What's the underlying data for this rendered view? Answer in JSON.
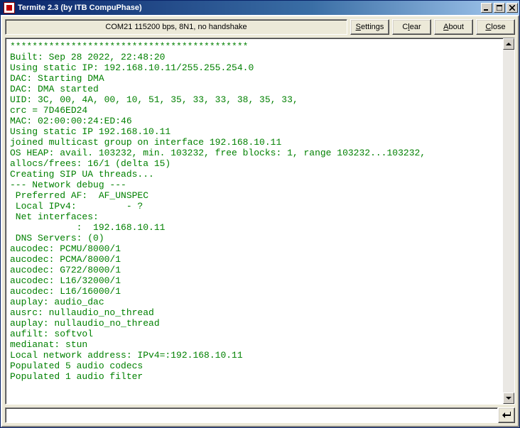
{
  "window": {
    "title": "Termite 2.3 (by ITB CompuPhase)"
  },
  "status": "COM21 115200 bps, 8N1, no handshake",
  "buttons": {
    "settings": "Settings",
    "clear": "Clear",
    "about": "About",
    "close": "Close"
  },
  "terminal_lines": [
    "*******************************************",
    "Built: Sep 28 2022, 22:48:20",
    "Using static IP: 192.168.10.11/255.255.254.0",
    "DAC: Starting DMA",
    "DAC: DMA started",
    "UID: 3C, 00, 4A, 00, 10, 51, 35, 33, 33, 38, 35, 33,",
    "crc = 7D46ED24",
    "MAC: 02:00:00:24:ED:46",
    "Using static IP 192.168.10.11",
    "joined multicast group on interface 192.168.10.11",
    "OS HEAP: avail. 103232, min. 103232, free blocks: 1, range 103232...103232,",
    "allocs/frees: 16/1 (delta 15)",
    "Creating SIP UA threads...",
    "--- Network debug ---",
    " Preferred AF:  AF_UNSPEC",
    " Local IPv4:         - ?",
    " Net interfaces:",
    "            :  192.168.10.11",
    " DNS Servers: (0)",
    "aucodec: PCMU/8000/1",
    "aucodec: PCMA/8000/1",
    "aucodec: G722/8000/1",
    "aucodec: L16/32000/1",
    "aucodec: L16/16000/1",
    "auplay: audio_dac",
    "ausrc: nullaudio_no_thread",
    "auplay: nullaudio_no_thread",
    "aufilt: softvol",
    "medianat: stun",
    "Local network address: IPv4=:192.168.10.11",
    "Populated 5 audio codecs",
    "Populated 1 audio filter"
  ],
  "input": {
    "value": ""
  }
}
